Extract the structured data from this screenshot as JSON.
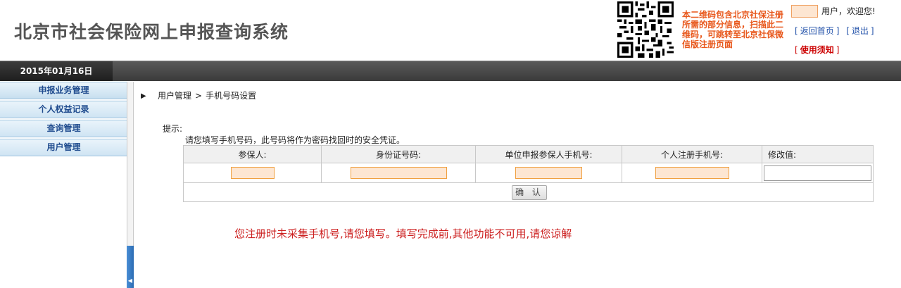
{
  "header": {
    "site_title": "北京市社会保险网上申报查询系统",
    "qr_text": "本二维码包含北京社保注册所需的部分信息，扫描此二维码，可跳转至北京社保微信版注册页面",
    "welcome": "用户，欢迎您!",
    "links": [
      "返回首页",
      "退出"
    ],
    "notice": "使用须知"
  },
  "datebar": {
    "date": "2015年01月16日"
  },
  "sidebar": {
    "items": [
      {
        "label": "申报业务管理"
      },
      {
        "label": "个人权益记录"
      },
      {
        "label": "查询管理"
      },
      {
        "label": "用户管理"
      }
    ]
  },
  "breadcrumb": {
    "parent": "用户管理",
    "current": "手机号码设置"
  },
  "tips": {
    "label": "提示:",
    "text": "请您填写手机号码，此号码将作为密码找回时的安全凭证。"
  },
  "table": {
    "headers": [
      "参保人:",
      "身份证号码:",
      "单位申报参保人手机号:",
      "个人注册手机号:",
      "修改值:"
    ],
    "edit_value": "",
    "confirm_label": "确 认"
  },
  "warning": "您注册时未采集手机号,请您填写。填写完成前,其他功能不可用,请您谅解",
  "colors": {
    "accent_orange": "#e8571b",
    "link_blue": "#1f4fa8",
    "warning_red": "#cc1f1f",
    "menu_text": "#1f4b8e"
  }
}
